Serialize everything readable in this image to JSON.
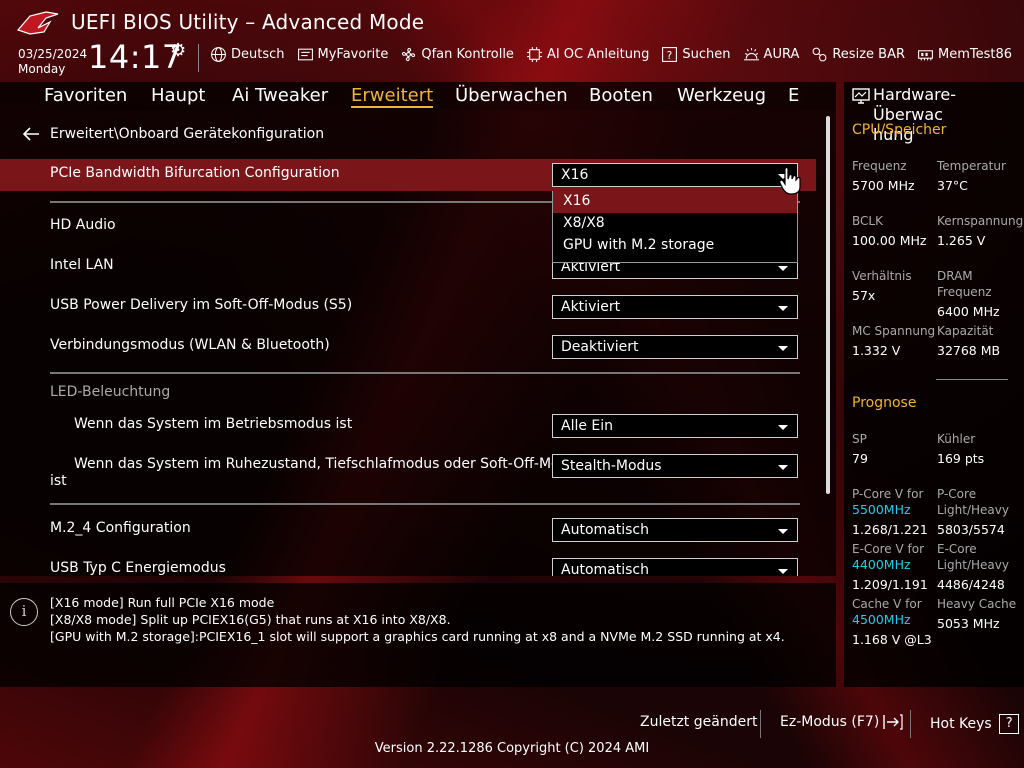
{
  "header": {
    "title": "UEFI BIOS Utility – Advanced Mode",
    "date": "03/25/2024",
    "day": "Monday",
    "time": "14:17",
    "toolbar": [
      {
        "label": "Deutsch",
        "icon": "globe-icon"
      },
      {
        "label": "MyFavorite",
        "icon": "favorite-icon"
      },
      {
        "label": "Qfan Kontrolle",
        "icon": "fan-icon"
      },
      {
        "label": "AI OC Anleitung",
        "icon": "ai-chip-icon"
      },
      {
        "label": "Suchen",
        "icon": "search-help-icon"
      },
      {
        "label": "AURA",
        "icon": "aura-icon"
      },
      {
        "label": "Resize BAR",
        "icon": "resize-bar-icon"
      },
      {
        "label": "MemTest86",
        "icon": "memtest-icon"
      }
    ]
  },
  "nav": {
    "tabs": [
      "Favoriten",
      "Haupt",
      "Ai Tweaker",
      "Erweitert",
      "Überwachen",
      "Booten",
      "Werkzeug",
      "E"
    ],
    "active": "Erweitert"
  },
  "main": {
    "breadcrumb": "Erweitert\\Onboard Gerätekonfiguration",
    "settings": {
      "pcie": {
        "label": "PCIe Bandwidth Bifurcation Configuration",
        "value": "X16"
      },
      "hd_audio": {
        "label": "HD Audio"
      },
      "intel_lan": {
        "label": "Intel LAN",
        "value": "Aktiviert"
      },
      "usb_pd": {
        "label": "USB Power Delivery im Soft-Off-Modus (S5)",
        "value": "Aktiviert"
      },
      "conn_mode": {
        "label": "Verbindungsmodus (WLAN & Bluetooth)",
        "value": "Deaktiviert"
      },
      "led_header": "LED-Beleuchtung",
      "led_run": {
        "label": "Wenn das System im Betriebsmodus ist",
        "value": "Alle Ein"
      },
      "led_sleep": {
        "label_line1": "Wenn das System im Ruhezustand, Tiefschlafmodus oder Soft-Off-Modus",
        "label_line2": "ist",
        "value": "Stealth-Modus"
      },
      "m2_4": {
        "label": "M.2_4 Configuration",
        "value": "Automatisch"
      },
      "usb_c": {
        "label": "USB Typ C Energiemodus",
        "value": "Automatisch"
      }
    },
    "dropdown_options": [
      "X16",
      "X8/X8",
      "GPU with M.2 storage"
    ],
    "dropdown_selected": "X16"
  },
  "help": {
    "lines": [
      "[X16 mode]  Run full PCIe X16 mode",
      "[X8/X8 mode] Split up PCIEX16(G5) that runs at X16 into X8/X8.",
      "[GPU with M.2 storage]:PCIEX16_1 slot will support a graphics card running at x8 and a NVMe M.2 SSD running at x4."
    ]
  },
  "hw": {
    "title_line1": "Hardware-Überwac",
    "title_line2": "hung",
    "cpu_section": "CPU/Speicher",
    "cpu": {
      "freq_label": "Frequenz",
      "freq_value": "5700 MHz",
      "temp_label": "Temperatur",
      "temp_value": "37°C",
      "bclk_label": "BCLK",
      "bclk_value": "100.00 MHz",
      "vcore_label": "Kernspannung",
      "vcore_value": "1.265 V",
      "ratio_label": "Verhältnis",
      "ratio_value": "57x",
      "dram_label_1": "DRAM",
      "dram_label_2": "Frequenz",
      "dram_value": "6400 MHz",
      "mcv_label": "MC Spannung",
      "mcv_value": "1.332 V",
      "cap_label": "Kapazität",
      "cap_value": "32768 MB"
    },
    "prog_section": "Prognose",
    "prog": {
      "sp_label": "SP",
      "sp_value": "79",
      "cooler_label": "Kühler",
      "cooler_value": "169 pts",
      "pcorev_label": "P-Core V for",
      "pcorev_freq": "5500MHz",
      "pcorev_value": "1.268/1.221",
      "pcore_lh_label_1": "P-Core",
      "pcore_lh_label_2": "Light/Heavy",
      "pcore_lh_value": "5803/5574",
      "ecorev_label": "E-Core V for",
      "ecorev_freq": "4400MHz",
      "ecorev_value": "1.209/1.191",
      "ecore_lh_label_1": "E-Core",
      "ecore_lh_label_2": "Light/Heavy",
      "ecore_lh_value": "4486/4248",
      "cachev_label": "Cache V for",
      "cachev_freq": "4500MHz",
      "cachev_value": "1.168 V @L3",
      "heavy_cache_label": "Heavy Cache",
      "heavy_cache_value": "5053 MHz"
    }
  },
  "footer": {
    "last_changed": "Zuletzt geändert",
    "ez_mode": "Ez-Modus (F7)",
    "hot_keys": "Hot Keys",
    "hot_keys_key": "?",
    "version": "Version 2.22.1286 Copyright (C) 2024 AMI"
  },
  "colors": {
    "accent": "#f0b435",
    "highlight": "#7a1519",
    "cyan": "#28c8e8"
  }
}
